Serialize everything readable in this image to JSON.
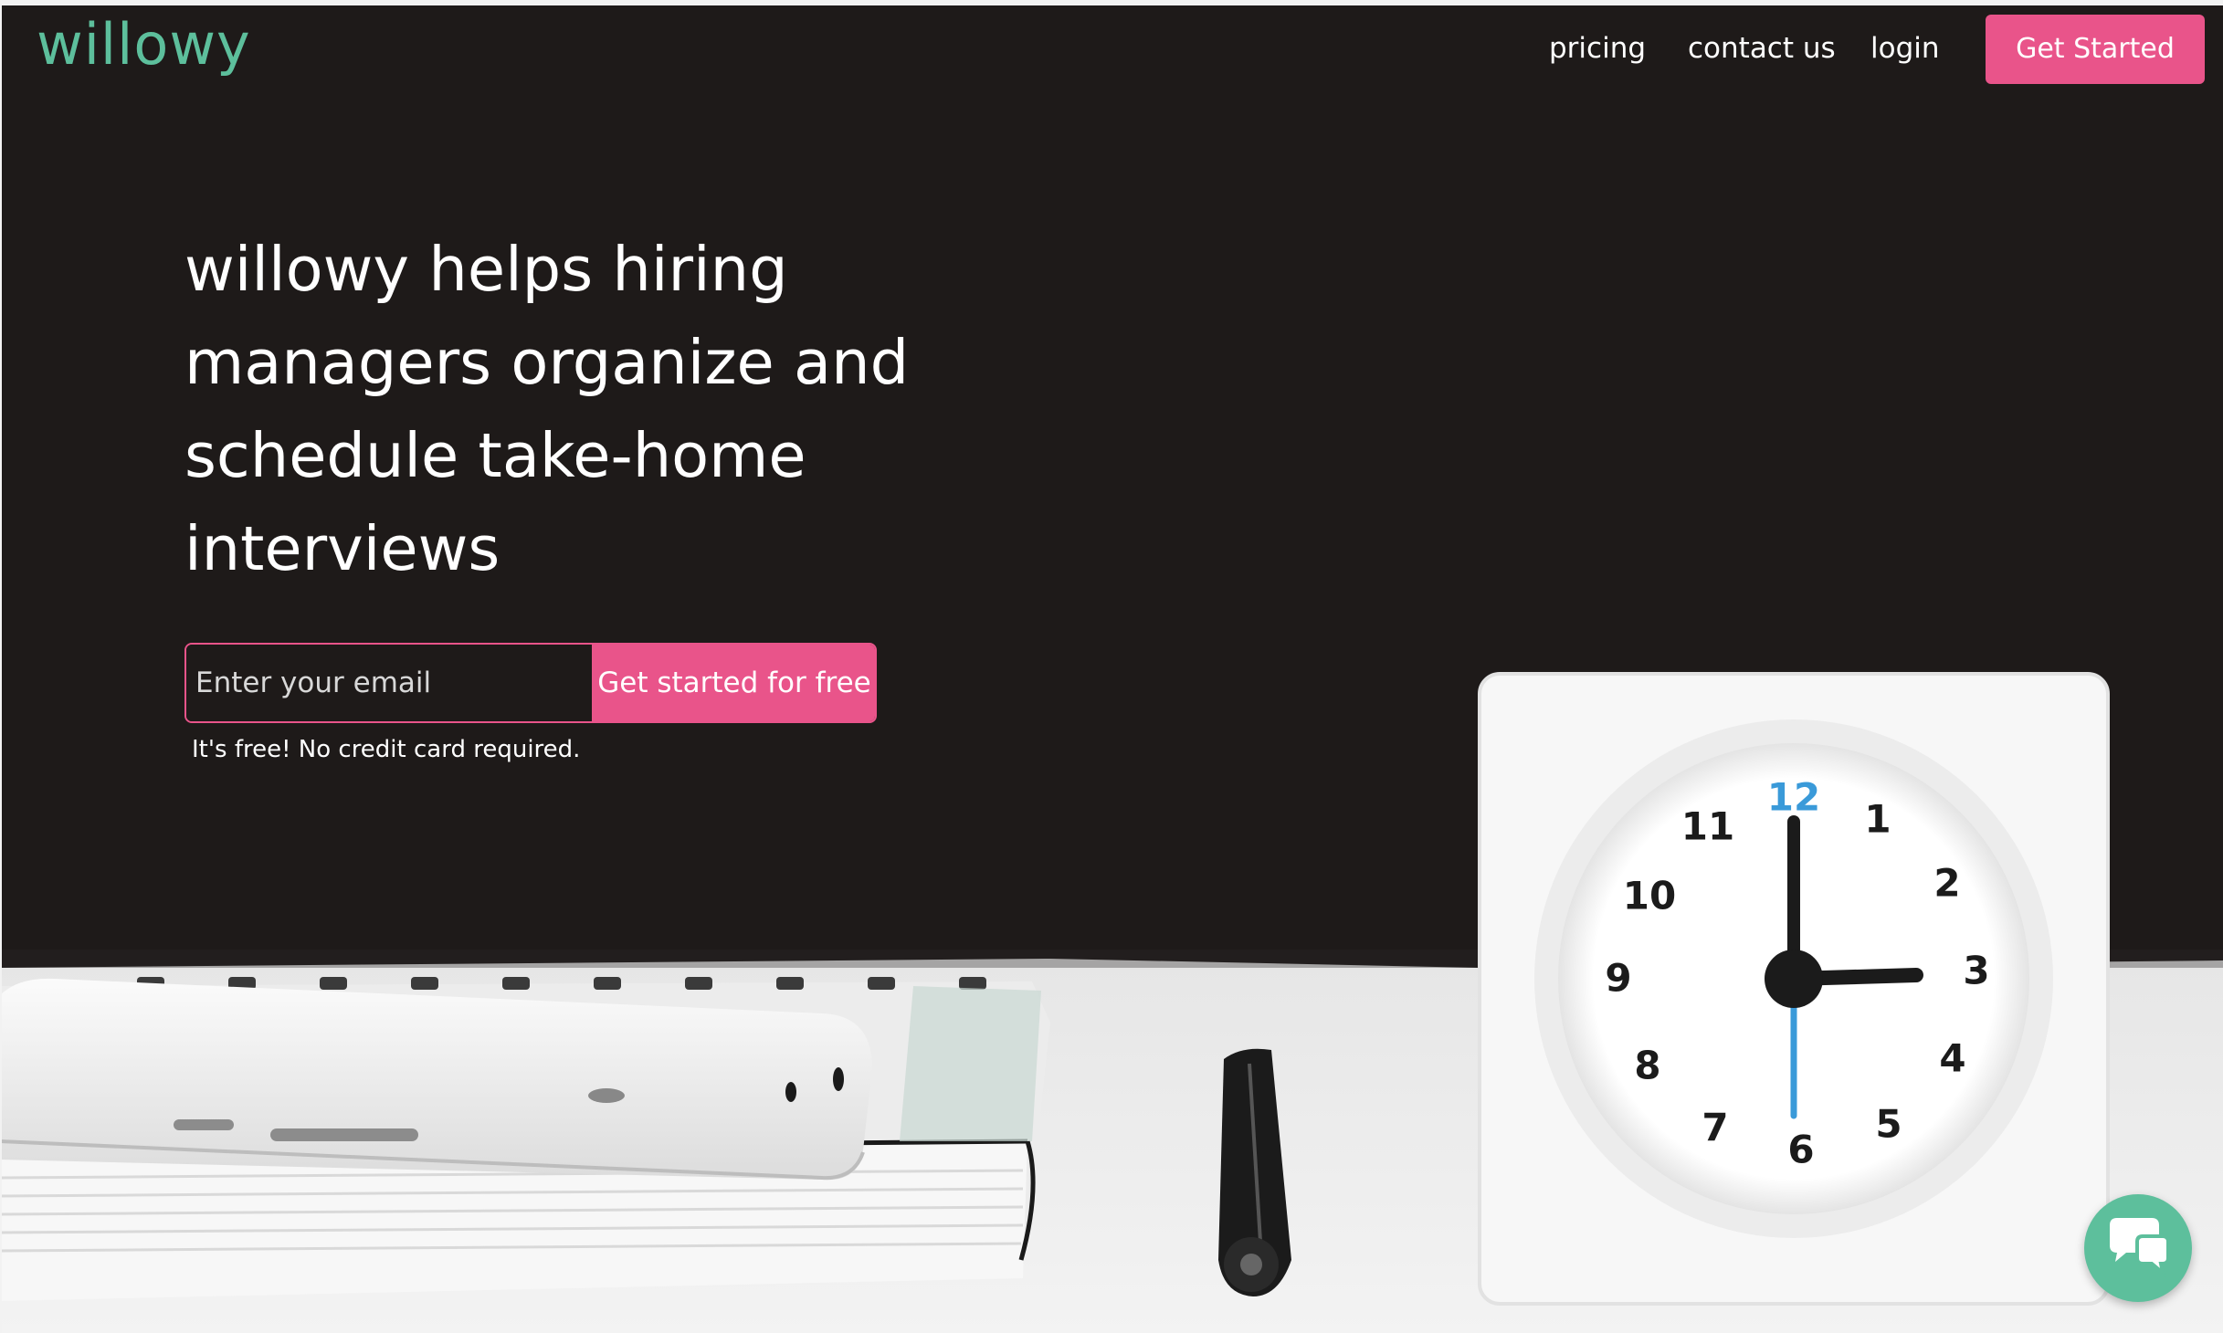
{
  "header": {
    "logo_text": "willowy",
    "nav": {
      "pricing": "pricing",
      "contact": "contact us",
      "login": "login"
    },
    "cta_label": "Get Started"
  },
  "hero": {
    "headline": "willowy helps hiring managers organize and schedule take-home interviews",
    "email_placeholder": "Enter your email",
    "submit_label": "Get started for free",
    "note": "It's free! No credit card required."
  },
  "background": {
    "clock_numbers": [
      "12",
      "1",
      "2",
      "3",
      "4",
      "5",
      "6",
      "7",
      "8",
      "9",
      "10",
      "11"
    ]
  },
  "colors": {
    "brand_green": "#5dbf9c",
    "brand_pink": "#e9548a",
    "background_dark": "#1e1a19"
  },
  "icons": {
    "chat": "chat-bubbles-icon"
  }
}
